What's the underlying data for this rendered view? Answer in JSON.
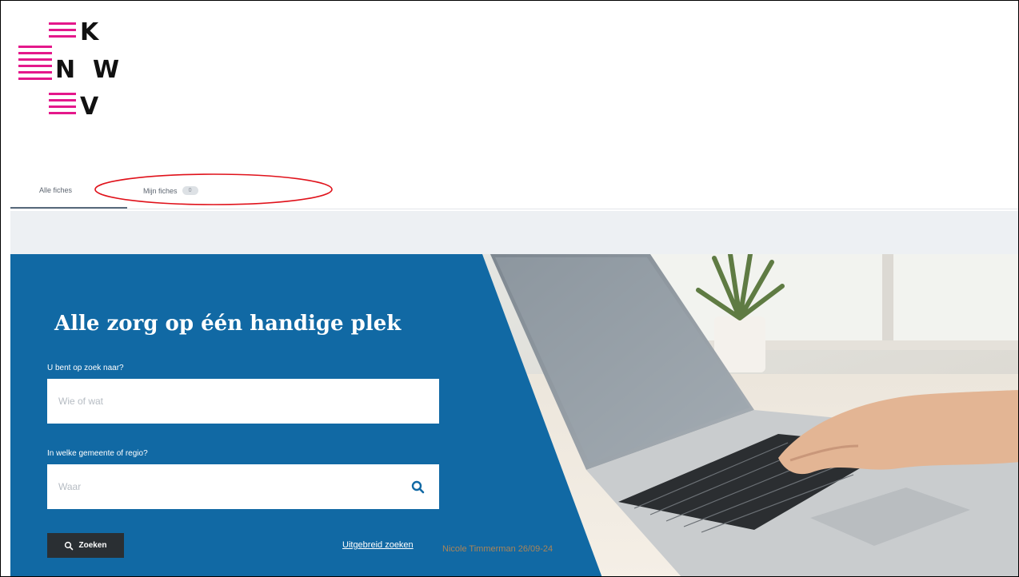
{
  "logo": {
    "letters": [
      "K",
      "N",
      "W",
      "V"
    ]
  },
  "tabs": [
    {
      "label": "Alle fiches",
      "active": true
    },
    {
      "label": "Mijn fiches",
      "badge": "0",
      "active": false
    }
  ],
  "hero": {
    "title": "Alle zorg op één handige plek",
    "search_what": {
      "label": "U bent op zoek naar?",
      "placeholder": "Wie of wat"
    },
    "search_where": {
      "label": "In welke gemeente of regio?",
      "placeholder": "Waar"
    },
    "search_button": "Zoeken",
    "advanced_link": "Uitgebreid zoeken"
  },
  "watermark": "Nicole Timmerman 26/09-24",
  "colors": {
    "brand_pink": "#e4188b",
    "hero_blue": "#1169a4",
    "annotation_red": "#e0121b",
    "button_dark": "#2a2f33"
  },
  "icons": [
    "search-icon"
  ]
}
